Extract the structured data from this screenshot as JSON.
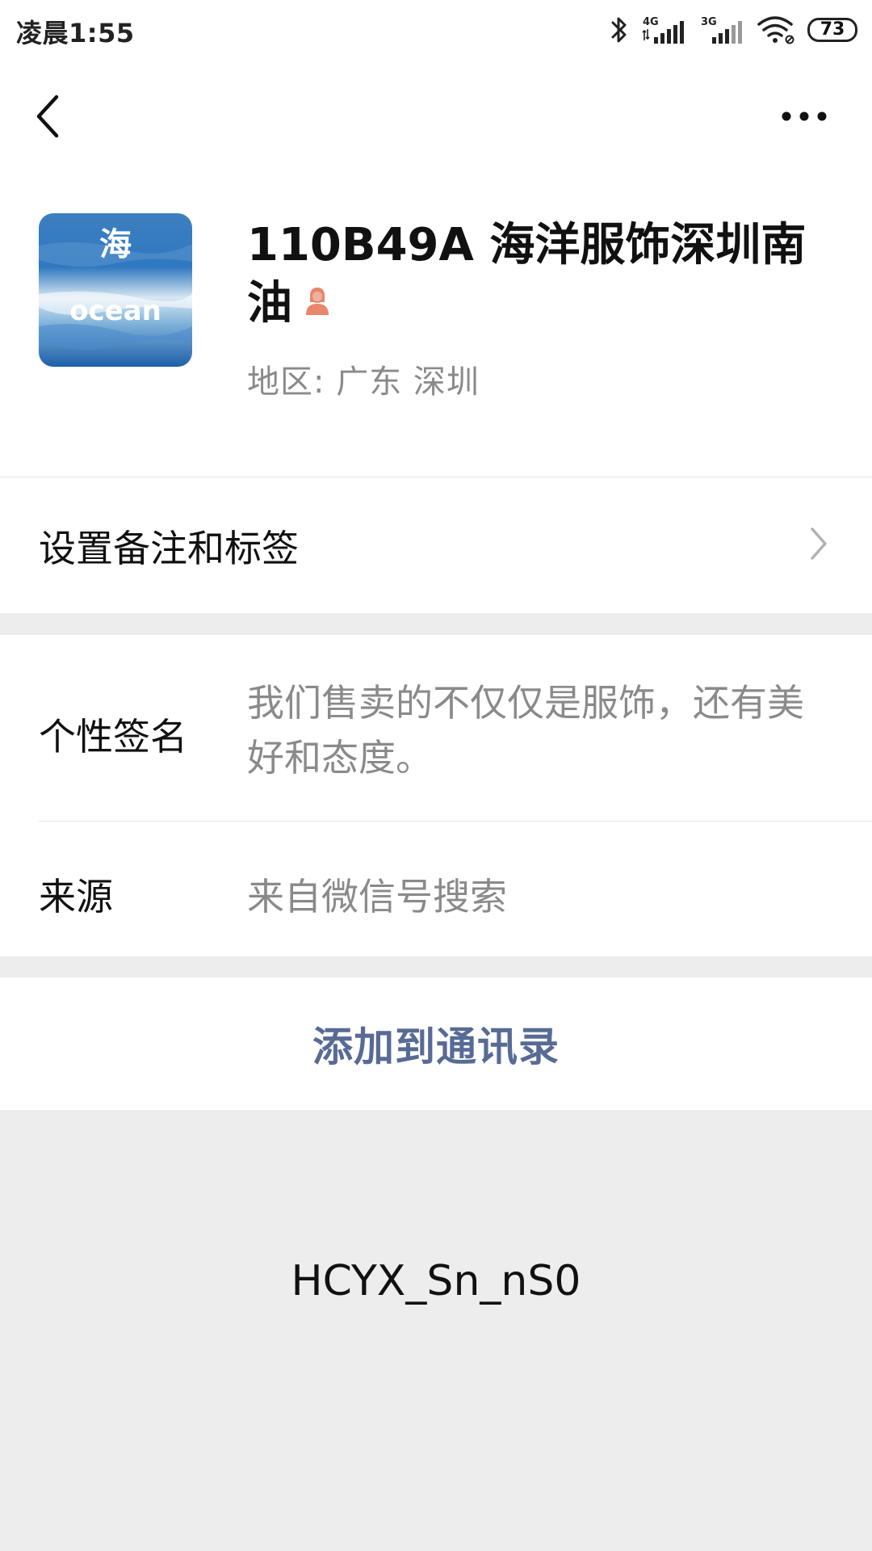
{
  "status_bar": {
    "time": "凌晨1:55",
    "network_1": "4G",
    "network_2": "3G",
    "battery": "73",
    "icons": [
      "bluetooth-icon",
      "signal-4g-icon",
      "signal-3g-icon",
      "wifi-icon",
      "battery-icon"
    ]
  },
  "nav": {
    "back_icon": "chevron-left-icon",
    "more_icon": "more-dots-icon"
  },
  "profile": {
    "avatar_text_top": "海",
    "avatar_text_bottom": "ocean",
    "name": "110B49A 海洋服饰深圳南油",
    "gender_icon": "female-icon",
    "gender_color": "#e9866b",
    "region_label": "地区:",
    "region_province": "广东",
    "region_city": "深圳"
  },
  "remark": {
    "label": "设置备注和标签",
    "chevron_icon": "chevron-right-icon"
  },
  "info": {
    "signature_label": "个性签名",
    "signature_value": "我们售卖的不仅仅是服饰，还有美好和态度。",
    "source_label": "来源",
    "source_value": "来自微信号搜索"
  },
  "actions": {
    "add_contact": "添加到通讯录",
    "accent_color": "#576b95"
  },
  "footer": {
    "text": "HCYX_Sn_nS0"
  }
}
